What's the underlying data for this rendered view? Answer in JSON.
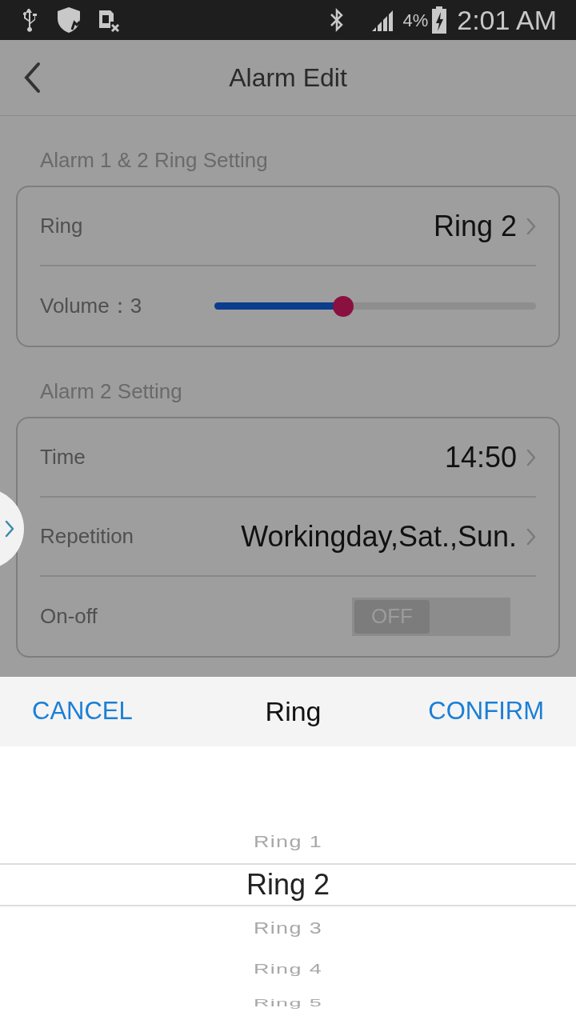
{
  "status_bar": {
    "battery": "4%",
    "time": "2:01 AM"
  },
  "header": {
    "title": "Alarm Edit"
  },
  "sections": [
    {
      "title": "Alarm 1 & 2 Ring Setting",
      "rows": [
        {
          "kind": "link",
          "label": "Ring",
          "value": "Ring 2"
        },
        {
          "kind": "slider",
          "label": "Volume：3",
          "level": 0.4
        }
      ]
    },
    {
      "title": "Alarm 2 Setting",
      "rows": [
        {
          "kind": "link",
          "label": "Time",
          "value": "14:50"
        },
        {
          "kind": "link",
          "label": "Repetition",
          "value": "Workingday,Sat.,Sun."
        },
        {
          "kind": "toggle",
          "label": "On-off",
          "on": false,
          "state_text": "OFF"
        }
      ]
    }
  ],
  "sheet": {
    "cancel": "CANCEL",
    "title": "Ring",
    "confirm": "CONFIRM",
    "options": [
      {
        "label": "Ring 1",
        "selected": false
      },
      {
        "label": "Ring 2",
        "selected": true
      },
      {
        "label": "Ring 3",
        "selected": false
      },
      {
        "label": "Ring 4",
        "selected": false
      },
      {
        "label": "Ring 5",
        "selected": false
      }
    ]
  }
}
